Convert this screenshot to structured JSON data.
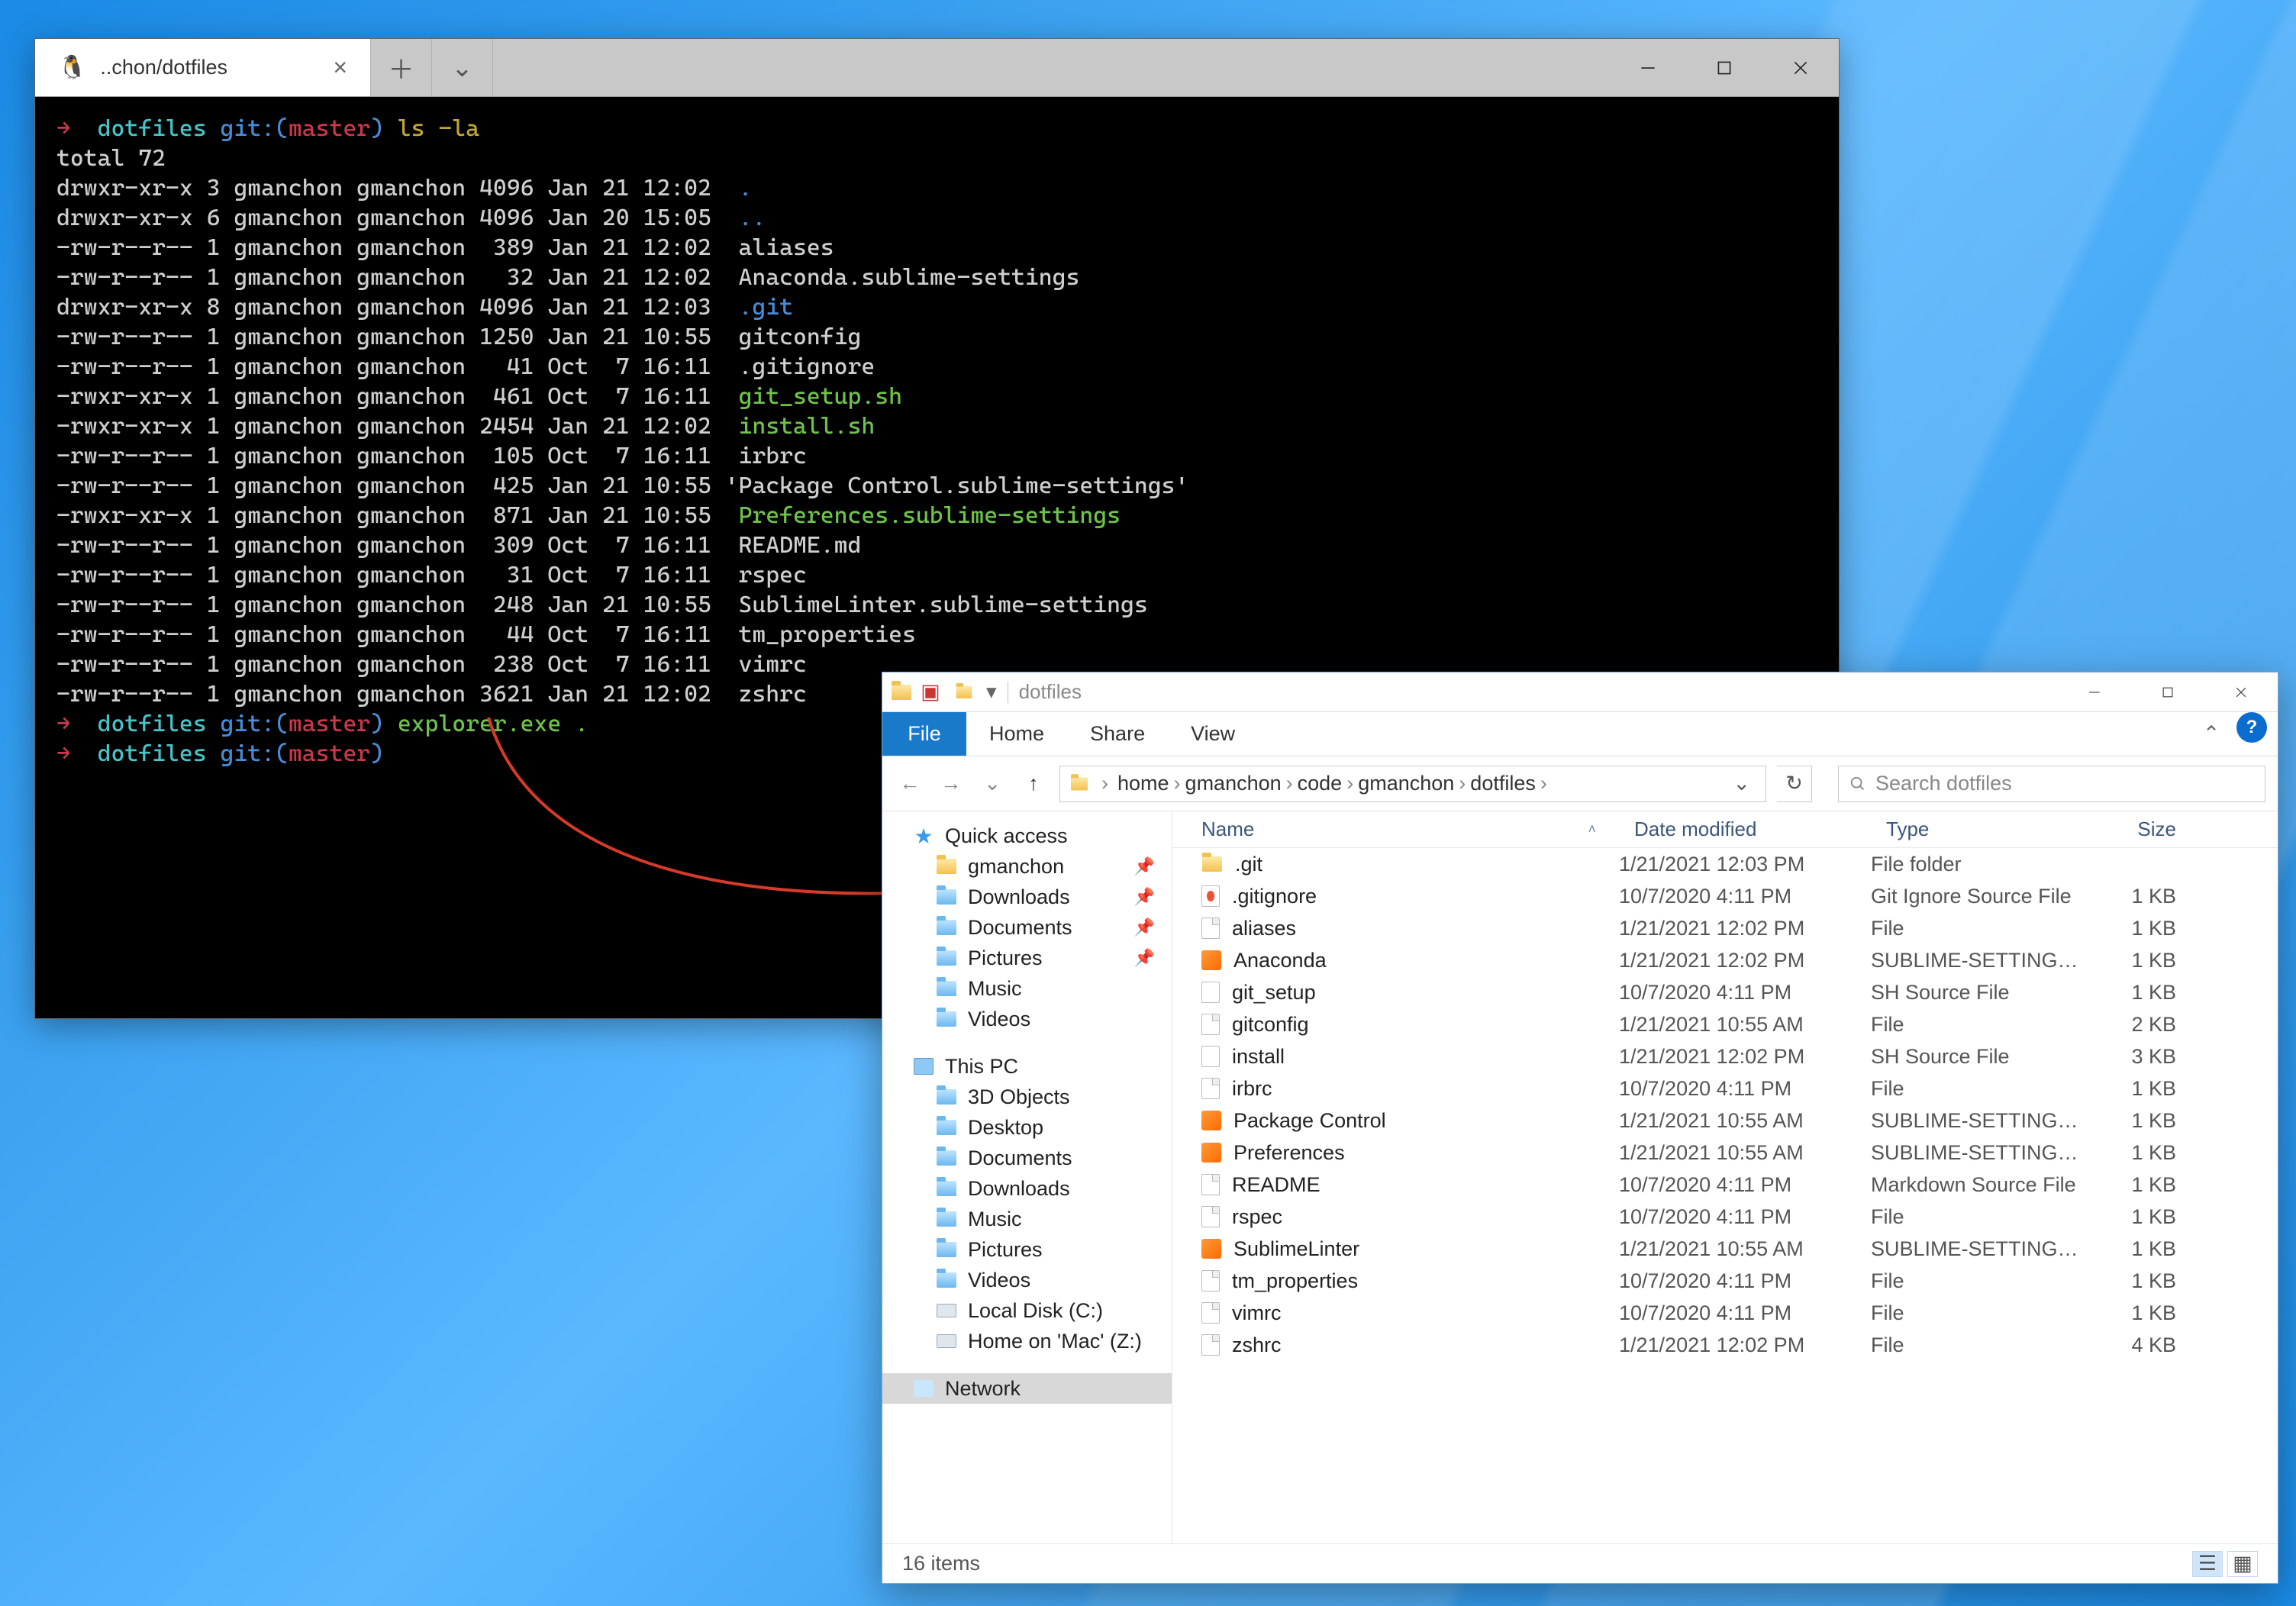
{
  "terminal": {
    "tabTitle": "..chon/dotfiles",
    "lines": [
      {
        "segments": [
          {
            "t": "→  ",
            "c": "tc-red"
          },
          {
            "t": "dotfiles ",
            "c": "tc-cyan"
          },
          {
            "t": "git:(",
            "c": "tc-blue"
          },
          {
            "t": "master",
            "c": "tc-red"
          },
          {
            "t": ") ",
            "c": "tc-blue"
          },
          {
            "t": "ls -la",
            "c": "tc-yellow"
          }
        ]
      },
      {
        "segments": [
          {
            "t": "total 72",
            "c": "tc-white"
          }
        ]
      },
      {
        "segments": [
          {
            "t": "drwxr-xr-x 3 gmanchon gmanchon 4096 Jan 21 12:02  ",
            "c": "tc-white"
          },
          {
            "t": ".",
            "c": "tc-blue"
          }
        ]
      },
      {
        "segments": [
          {
            "t": "drwxr-xr-x 6 gmanchon gmanchon 4096 Jan 20 15:05  ",
            "c": "tc-white"
          },
          {
            "t": "..",
            "c": "tc-blue"
          }
        ]
      },
      {
        "segments": [
          {
            "t": "-rw-r--r-- 1 gmanchon gmanchon  389 Jan 21 12:02  aliases",
            "c": "tc-white"
          }
        ]
      },
      {
        "segments": [
          {
            "t": "-rw-r--r-- 1 gmanchon gmanchon   32 Jan 21 12:02  Anaconda.sublime-settings",
            "c": "tc-white"
          }
        ]
      },
      {
        "segments": [
          {
            "t": "drwxr-xr-x 8 gmanchon gmanchon 4096 Jan 21 12:03  ",
            "c": "tc-white"
          },
          {
            "t": ".git",
            "c": "tc-blue"
          }
        ]
      },
      {
        "segments": [
          {
            "t": "-rw-r--r-- 1 gmanchon gmanchon 1250 Jan 21 10:55  gitconfig",
            "c": "tc-white"
          }
        ]
      },
      {
        "segments": [
          {
            "t": "-rw-r--r-- 1 gmanchon gmanchon   41 Oct  7 16:11  .gitignore",
            "c": "tc-white"
          }
        ]
      },
      {
        "segments": [
          {
            "t": "-rwxr-xr-x 1 gmanchon gmanchon  461 Oct  7 16:11  ",
            "c": "tc-white"
          },
          {
            "t": "git_setup.sh",
            "c": "tc-green"
          }
        ]
      },
      {
        "segments": [
          {
            "t": "-rwxr-xr-x 1 gmanchon gmanchon 2454 Jan 21 12:02  ",
            "c": "tc-white"
          },
          {
            "t": "install.sh",
            "c": "tc-green"
          }
        ]
      },
      {
        "segments": [
          {
            "t": "-rw-r--r-- 1 gmanchon gmanchon  105 Oct  7 16:11  irbrc",
            "c": "tc-white"
          }
        ]
      },
      {
        "segments": [
          {
            "t": "-rw-r--r-- 1 gmanchon gmanchon  425 Jan 21 10:55 'Package Control.sublime-settings'",
            "c": "tc-white"
          }
        ]
      },
      {
        "segments": [
          {
            "t": "-rwxr-xr-x 1 gmanchon gmanchon  871 Jan 21 10:55  ",
            "c": "tc-white"
          },
          {
            "t": "Preferences.sublime-settings",
            "c": "tc-green"
          }
        ]
      },
      {
        "segments": [
          {
            "t": "-rw-r--r-- 1 gmanchon gmanchon  309 Oct  7 16:11  README.md",
            "c": "tc-white"
          }
        ]
      },
      {
        "segments": [
          {
            "t": "-rw-r--r-- 1 gmanchon gmanchon   31 Oct  7 16:11  rspec",
            "c": "tc-white"
          }
        ]
      },
      {
        "segments": [
          {
            "t": "-rw-r--r-- 1 gmanchon gmanchon  248 Jan 21 10:55  SublimeLinter.sublime-settings",
            "c": "tc-white"
          }
        ]
      },
      {
        "segments": [
          {
            "t": "-rw-r--r-- 1 gmanchon gmanchon   44 Oct  7 16:11  tm_properties",
            "c": "tc-white"
          }
        ]
      },
      {
        "segments": [
          {
            "t": "-rw-r--r-- 1 gmanchon gmanchon  238 Oct  7 16:11  vimrc",
            "c": "tc-white"
          }
        ]
      },
      {
        "segments": [
          {
            "t": "-rw-r--r-- 1 gmanchon gmanchon 3621 Jan 21 12:02  zshrc",
            "c": "tc-white"
          }
        ]
      },
      {
        "segments": [
          {
            "t": "→  ",
            "c": "tc-red"
          },
          {
            "t": "dotfiles ",
            "c": "tc-cyan"
          },
          {
            "t": "git:(",
            "c": "tc-blue"
          },
          {
            "t": "master",
            "c": "tc-red"
          },
          {
            "t": ") ",
            "c": "tc-blue"
          },
          {
            "t": "explorer.exe .",
            "c": "tc-green"
          }
        ]
      },
      {
        "segments": [
          {
            "t": "→  ",
            "c": "tc-red"
          },
          {
            "t": "dotfiles ",
            "c": "tc-cyan"
          },
          {
            "t": "git:(",
            "c": "tc-blue"
          },
          {
            "t": "master",
            "c": "tc-red"
          },
          {
            "t": ")",
            "c": "tc-blue"
          }
        ]
      }
    ]
  },
  "explorer": {
    "title": "dotfiles",
    "ribbon": {
      "file": "File",
      "tabs": [
        "Home",
        "Share",
        "View"
      ]
    },
    "breadcrumbs": [
      "home",
      "gmanchon",
      "code",
      "gmanchon",
      "dotfiles"
    ],
    "searchPlaceholder": "Search dotfiles",
    "nav": {
      "quickAccess": "Quick access",
      "qa": [
        {
          "label": "gmanchon",
          "icon": "fld-gold",
          "pin": true
        },
        {
          "label": "Downloads",
          "icon": "fld-blue",
          "pin": true
        },
        {
          "label": "Documents",
          "icon": "fld-blue",
          "pin": true
        },
        {
          "label": "Pictures",
          "icon": "fld-blue",
          "pin": true
        },
        {
          "label": "Music",
          "icon": "fld-blue",
          "pin": false
        },
        {
          "label": "Videos",
          "icon": "fld-blue",
          "pin": false
        }
      ],
      "thisPC": "This PC",
      "pc": [
        {
          "label": "3D Objects",
          "icon": "fld-blue"
        },
        {
          "label": "Desktop",
          "icon": "fld-blue"
        },
        {
          "label": "Documents",
          "icon": "fld-blue"
        },
        {
          "label": "Downloads",
          "icon": "fld-blue"
        },
        {
          "label": "Music",
          "icon": "fld-blue"
        },
        {
          "label": "Pictures",
          "icon": "fld-blue"
        },
        {
          "label": "Videos",
          "icon": "fld-blue"
        },
        {
          "label": "Local Disk (C:)",
          "icon": "disk-ico"
        },
        {
          "label": "Home on 'Mac' (Z:)",
          "icon": "disk-ico"
        }
      ],
      "network": "Network"
    },
    "columns": {
      "name": "Name",
      "date": "Date modified",
      "type": "Type",
      "size": "Size"
    },
    "rows": [
      {
        "icon": "folder",
        "name": ".git",
        "date": "1/21/2021 12:03 PM",
        "type": "File folder",
        "size": ""
      },
      {
        "icon": "gi",
        "name": ".gitignore",
        "date": "10/7/2020 4:11 PM",
        "type": "Git Ignore Source File",
        "size": "1 KB"
      },
      {
        "icon": "file",
        "name": "aliases",
        "date": "1/21/2021 12:02 PM",
        "type": "File",
        "size": "1 KB"
      },
      {
        "icon": "subl",
        "name": "Anaconda",
        "date": "1/21/2021 12:02 PM",
        "type": "SUBLIME-SETTINGS F…",
        "size": "1 KB"
      },
      {
        "icon": "sh",
        "name": "git_setup",
        "date": "10/7/2020 4:11 PM",
        "type": "SH Source File",
        "size": "1 KB"
      },
      {
        "icon": "file",
        "name": "gitconfig",
        "date": "1/21/2021 10:55 AM",
        "type": "File",
        "size": "2 KB"
      },
      {
        "icon": "sh",
        "name": "install",
        "date": "1/21/2021 12:02 PM",
        "type": "SH Source File",
        "size": "3 KB"
      },
      {
        "icon": "file",
        "name": "irbrc",
        "date": "10/7/2020 4:11 PM",
        "type": "File",
        "size": "1 KB"
      },
      {
        "icon": "subl",
        "name": "Package Control",
        "date": "1/21/2021 10:55 AM",
        "type": "SUBLIME-SETTINGS F…",
        "size": "1 KB"
      },
      {
        "icon": "subl",
        "name": "Preferences",
        "date": "1/21/2021 10:55 AM",
        "type": "SUBLIME-SETTINGS F…",
        "size": "1 KB"
      },
      {
        "icon": "file",
        "name": "README",
        "date": "10/7/2020 4:11 PM",
        "type": "Markdown Source File",
        "size": "1 KB"
      },
      {
        "icon": "file",
        "name": "rspec",
        "date": "10/7/2020 4:11 PM",
        "type": "File",
        "size": "1 KB"
      },
      {
        "icon": "subl",
        "name": "SublimeLinter",
        "date": "1/21/2021 10:55 AM",
        "type": "SUBLIME-SETTINGS F…",
        "size": "1 KB"
      },
      {
        "icon": "file",
        "name": "tm_properties",
        "date": "10/7/2020 4:11 PM",
        "type": "File",
        "size": "1 KB"
      },
      {
        "icon": "file",
        "name": "vimrc",
        "date": "10/7/2020 4:11 PM",
        "type": "File",
        "size": "1 KB"
      },
      {
        "icon": "file",
        "name": "zshrc",
        "date": "1/21/2021 12:02 PM",
        "type": "File",
        "size": "4 KB"
      }
    ],
    "status": "16 items"
  }
}
